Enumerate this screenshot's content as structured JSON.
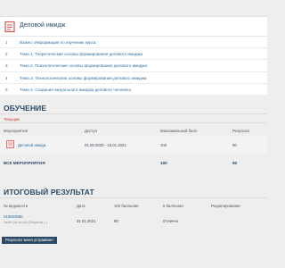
{
  "course": {
    "title": "Деловой имидж",
    "icon": "document-icon",
    "modules": [
      {
        "num": "1",
        "label": "Важно: Информация по изучению курса"
      },
      {
        "num": "2",
        "label": "Тема 1. Теоретические основы формирования делового имиджа"
      },
      {
        "num": "3",
        "label": "Тема 2. Психологические основы формирования делового имиджа"
      },
      {
        "num": "4",
        "label": "Тема 3. Технологические основы формирования делового имиджа"
      },
      {
        "num": "5",
        "label": "Тема 4. Создание визуального имиджа делового человека"
      }
    ]
  },
  "training": {
    "title": "ОБУЧЕНИЕ",
    "tab": "Текущие",
    "headers": {
      "activities": "Мероприятия",
      "access": "Доступ",
      "max_score": "Максимальный балл",
      "result": "Результат"
    },
    "row": {
      "name": "Деловой имидж",
      "access": "01.08.2020 - 16.01.2021",
      "max_score": "100",
      "result": "90"
    },
    "total": {
      "label": "ВСЕ МЕРОПРИЯТИЯ",
      "max_score": "100",
      "result": "90"
    }
  },
  "final": {
    "title": "ИТОГОВЫЙ РЕЗУЛЬТАТ",
    "headers": {
      "statement": "№ ведомости",
      "date": "Дата",
      "score100": "100 балльная",
      "score5": "5 балльная",
      "edit": "Редактирование"
    },
    "row": {
      "statement": "015583960",
      "statement_sub": "Зачёт (по сп-ти) (Открыта) (-)",
      "date": "31.01.2021",
      "score100": "90",
      "score5": "Отлично"
    },
    "button": "Результат меня устраивает"
  },
  "colors": {
    "accent": "#2b4a66",
    "link": "#2e6fa3",
    "tab_active": "#c0392b",
    "icon": "#d9534f"
  }
}
